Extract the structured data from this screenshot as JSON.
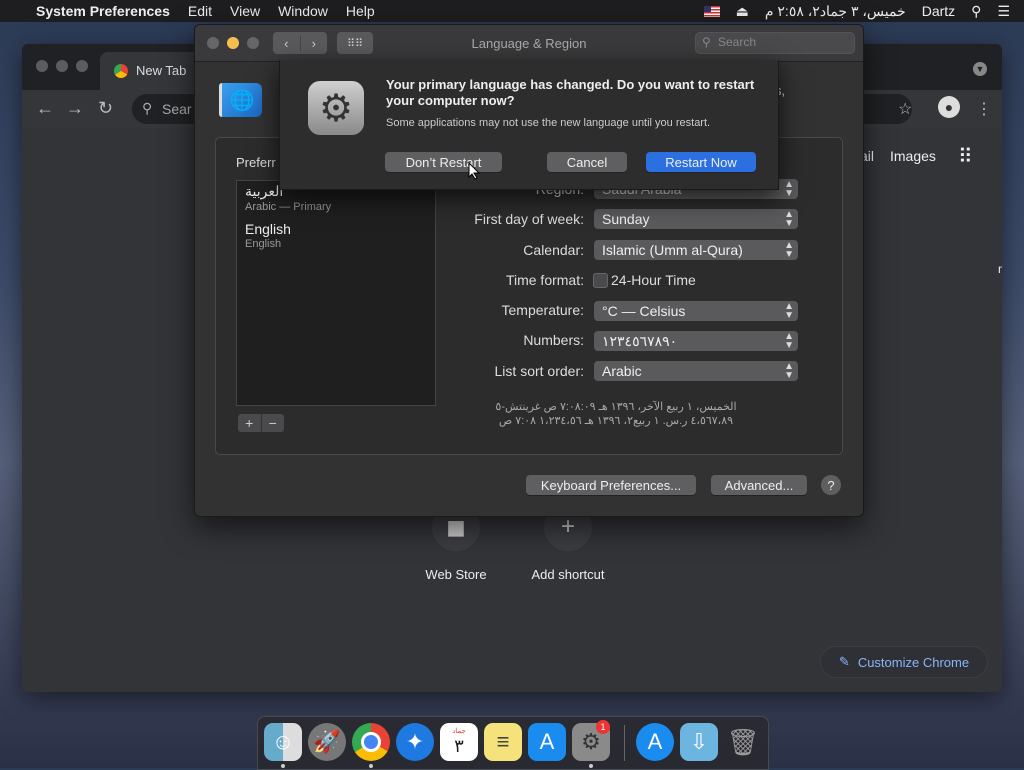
{
  "menubar": {
    "app_name": "System Preferences",
    "items": [
      "Edit",
      "View",
      "Window",
      "Help"
    ],
    "clock": "خميس، ٣ جماد٢، ٢:٥٨ م",
    "user": "Dartz"
  },
  "chrome": {
    "tab_title": "New Tab",
    "omnibox_placeholder": "Sear",
    "links": {
      "gmail_partial": "ail",
      "images": "Images"
    },
    "side_partial": "m",
    "shortcuts": [
      {
        "label": "Web Store"
      },
      {
        "label": "Add shortcut"
      }
    ],
    "customize_label": "Customize Chrome"
  },
  "lr_window": {
    "title": "Language & Region",
    "search_placeholder": "Search",
    "header_partial": "s,",
    "preferred_label": "Preferr",
    "languages": [
      {
        "name": "العربية",
        "subtitle": "Arabic — Primary"
      },
      {
        "name": "English",
        "subtitle": "English"
      }
    ],
    "add_label": "+",
    "remove_label": "−",
    "settings": {
      "region_label": "Region:",
      "region_value": "Saudi Arabia",
      "first_day_label": "First day of week:",
      "first_day_value": "Sunday",
      "calendar_label": "Calendar:",
      "calendar_value": "Islamic (Umm al-Qura)",
      "time_format_label": "Time format:",
      "time_format_check": "24-Hour Time",
      "temperature_label": "Temperature:",
      "temperature_value": "°C — Celsius",
      "numbers_label": "Numbers:",
      "numbers_value": "١٢٣٤٥٦٧٨٩٠",
      "sort_label": "List sort order:",
      "sort_value": "Arabic"
    },
    "sample_line1": "الخميس، ١ ربيع الآخر، ١٣٩٦ هـ ٧:٠٨:٠٩ ص غرينتش-٥",
    "sample_line2": "٤،٥٦٧،٨٩ ر.س.     ١ ربيع٢، ١٣٩٦ هـ     ١،٢٣٤،٥٦     ٧:٠٨ ص",
    "keyboard_button": "Keyboard Preferences...",
    "advanced_button": "Advanced...",
    "help_label": "?"
  },
  "alert": {
    "title": "Your primary language has changed. Do you want to restart your computer now?",
    "body": "Some applications may not use the new language until you restart.",
    "dont_restart": "Don’t Restart",
    "cancel": "Cancel",
    "restart_now": "Restart Now"
  },
  "dock": {
    "calendar_day": "٣",
    "calendar_month": "جماد",
    "sysprefs_badge": "1"
  }
}
